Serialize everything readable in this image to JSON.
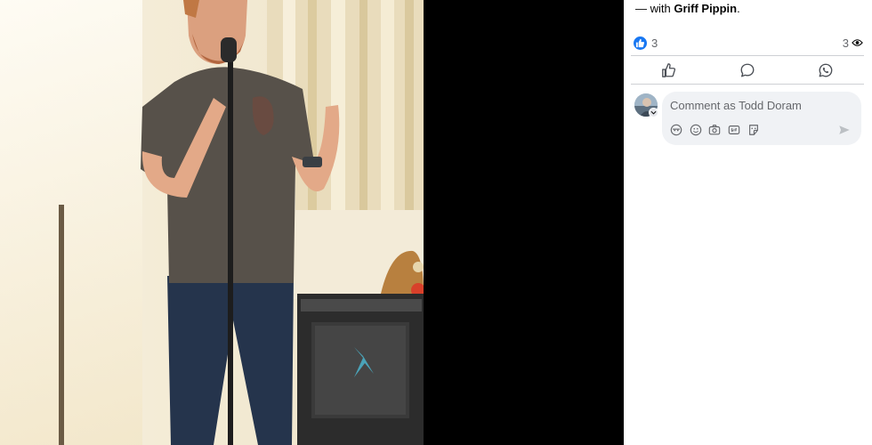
{
  "post": {
    "tag_prefix": "— with ",
    "tagged_name": "Griff Pippin",
    "tag_suffix": "."
  },
  "reactions": {
    "like_icon": "thumbs-up-icon",
    "like_count": "3",
    "view_count": "3",
    "view_icon": "eye-icon"
  },
  "actions": [
    {
      "name": "like-action-button",
      "icon": "thumbs-up-outline-icon"
    },
    {
      "name": "comment-action-button",
      "icon": "speech-bubble-icon"
    },
    {
      "name": "whatsapp-share-button",
      "icon": "whatsapp-icon"
    }
  ],
  "comment": {
    "placeholder": "Comment as Todd Doram",
    "tools": [
      "avatar-sticker-icon",
      "emoji-icon",
      "camera-icon",
      "gif-icon",
      "sticker-icon"
    ],
    "send_icon": "send-icon"
  },
  "colors": {
    "accent": "#1877f2",
    "viewer_bg": "#000000",
    "panel_bg": "#ffffff",
    "input_bg": "#f0f2f5"
  }
}
